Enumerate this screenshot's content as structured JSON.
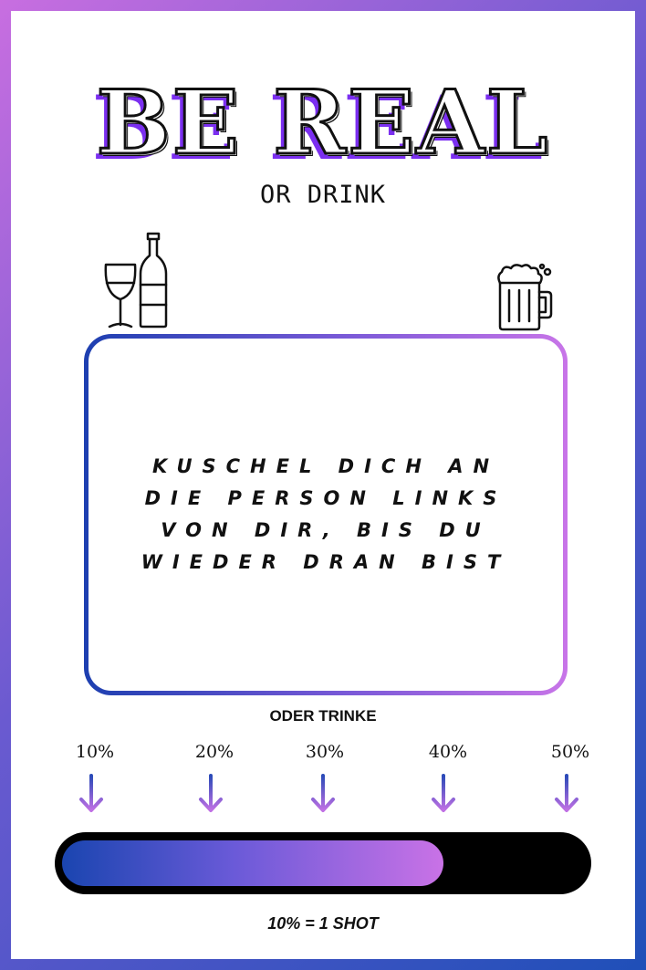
{
  "header": {
    "title": "BE REAL",
    "subtitle": "OR DRINK"
  },
  "icons": {
    "left": "wine-glass-and-bottle-icon",
    "right": "beer-mug-icon"
  },
  "task": {
    "text": "KUSCHEL DICH AN DIE PERSON LINKS VON DIR, BIS DU WIEDER DRAN BIST"
  },
  "alternative": {
    "label": "ODER TRINKE"
  },
  "scale": {
    "labels": [
      "10%",
      "20%",
      "30%",
      "40%",
      "50%"
    ],
    "progress_fraction": 0.73
  },
  "footer": {
    "note": "10% = 1 SHOT"
  },
  "colors": {
    "accent_purple": "#7b2ff0",
    "gradient_blue": "#1d3fb0",
    "gradient_pink": "#c875e8"
  }
}
